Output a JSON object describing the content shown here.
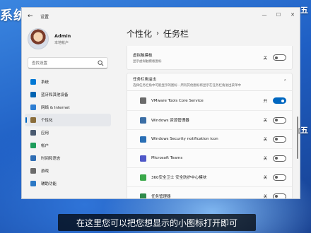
{
  "desktop": {
    "watermark": "系统",
    "right_fragment_1": "五",
    "right_fragment_2": "五"
  },
  "window": {
    "app_title": "设置",
    "back_glyph": "←",
    "controls": {
      "minimize": "—",
      "maximize": "☐",
      "close": "✕"
    }
  },
  "profile": {
    "name": "Admin",
    "type": "本地帐户"
  },
  "search": {
    "placeholder": "查找设置"
  },
  "nav": [
    {
      "label": "系统",
      "icon": "system-icon",
      "color": "#0078d4"
    },
    {
      "label": "蓝牙和其他设备",
      "icon": "bluetooth-icon",
      "color": "#0063b1"
    },
    {
      "label": "网络 & Internet",
      "icon": "network-icon",
      "color": "#2d7dd2"
    },
    {
      "label": "个性化",
      "icon": "personalization-icon",
      "color": "#8a6d3b",
      "active": true
    },
    {
      "label": "应用",
      "icon": "apps-icon",
      "color": "#4a5a70"
    },
    {
      "label": "帐户",
      "icon": "accounts-icon",
      "color": "#1c9c5a"
    },
    {
      "label": "时间和语言",
      "icon": "time-language-icon",
      "color": "#2f6db3"
    },
    {
      "label": "游戏",
      "icon": "gaming-icon",
      "color": "#6b6b6b"
    },
    {
      "label": "辅助功能",
      "icon": "accessibility-icon",
      "color": "#2b78c5"
    }
  ],
  "breadcrumb": {
    "parent": "个性化",
    "separator": "›",
    "current": "任务栏"
  },
  "top_item": {
    "label": "虚拟触摸板",
    "desc": "显示虚拟触摸板图标",
    "state": "关",
    "on": false
  },
  "section": {
    "title": "任务栏角溢出",
    "desc": "选择任务栏角中可能显示的图标 - 所有其他图标将显示在任务栏角溢出菜单中",
    "chevron": "˄"
  },
  "rows": [
    {
      "label": "VMware Tools Core Service",
      "state": "开",
      "on": true,
      "icon": "vmware-icon",
      "color": "#6b6b6b"
    },
    {
      "label": "Windows 资源管理器",
      "state": "关",
      "on": false,
      "icon": "file-explorer-icon",
      "color": "#3b6ea5"
    },
    {
      "label": "Windows Security notification icon",
      "state": "关",
      "on": false,
      "icon": "windows-security-icon",
      "color": "#2a6fb5"
    },
    {
      "label": "Microsoft Teams",
      "state": "关",
      "on": false,
      "icon": "teams-icon",
      "color": "#4f58c8"
    },
    {
      "label": "360安全卫士 安全防护中心模块",
      "state": "关",
      "on": false,
      "icon": "360-security-icon",
      "color": "#3aa84a"
    },
    {
      "label": "任务管理器",
      "state": "关",
      "on": false,
      "icon": "task-manager-icon",
      "color": "#2f8a4a"
    }
  ],
  "subtitle": "在这里您可以把您想显示的小图标打开即可"
}
